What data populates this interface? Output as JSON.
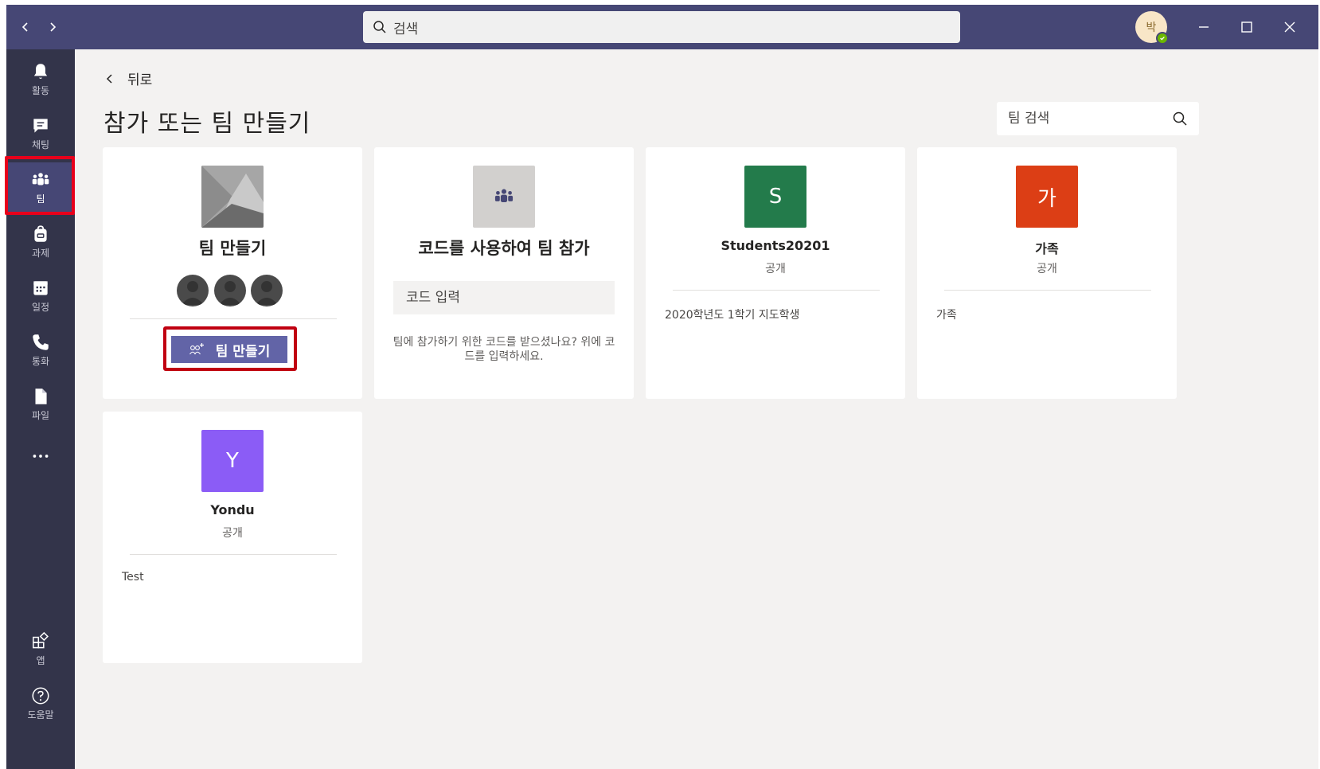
{
  "titlebar": {
    "search_placeholder": "검색",
    "avatar_initial": "박",
    "colors": {
      "bg": "#464775",
      "search_bg": "#f0f0f0"
    }
  },
  "rail": {
    "items": [
      {
        "label": "활동",
        "icon": "bell-icon"
      },
      {
        "label": "채팅",
        "icon": "chat-icon"
      },
      {
        "label": "팀",
        "icon": "teams-icon",
        "active": true
      },
      {
        "label": "과제",
        "icon": "backpack-icon"
      },
      {
        "label": "일정",
        "icon": "calendar-icon"
      },
      {
        "label": "통화",
        "icon": "phone-icon"
      },
      {
        "label": "파일",
        "icon": "file-icon"
      },
      {
        "label": "앱",
        "icon": "apps-icon"
      },
      {
        "label": "도움말",
        "icon": "help-icon"
      }
    ],
    "colors": {
      "bg": "#33344a",
      "highlight": "#e8001b"
    }
  },
  "main": {
    "back_label": "뒤로",
    "page_title": "참가 또는 팀 만들기",
    "team_search_placeholder": "팀 검색",
    "create_card": {
      "title": "팀 만들기",
      "button_label": "팀 만들기"
    },
    "join_card": {
      "title": "코드를 사용하여 팀 참가",
      "input_placeholder": "코드 입력",
      "hint": "팀에 참가하기 위한 코드를 받으셨나요? 위에 코드를 입력하세요."
    },
    "teams": [
      {
        "initial": "S",
        "name": "Students20201",
        "privacy": "공개",
        "description": "2020학년도 1학기 지도학생",
        "color": "#237b4b"
      },
      {
        "initial": "가",
        "name": "가족",
        "privacy": "공개",
        "description": "가족",
        "color": "#dc3e15"
      },
      {
        "initial": "Y",
        "name": "Yondu",
        "privacy": "공개",
        "description": "Test",
        "color": "#8b5cf6"
      }
    ],
    "colors": {
      "accent": "#6264a7",
      "page_bg": "#f3f2f1",
      "card_bg": "#ffffff"
    }
  }
}
